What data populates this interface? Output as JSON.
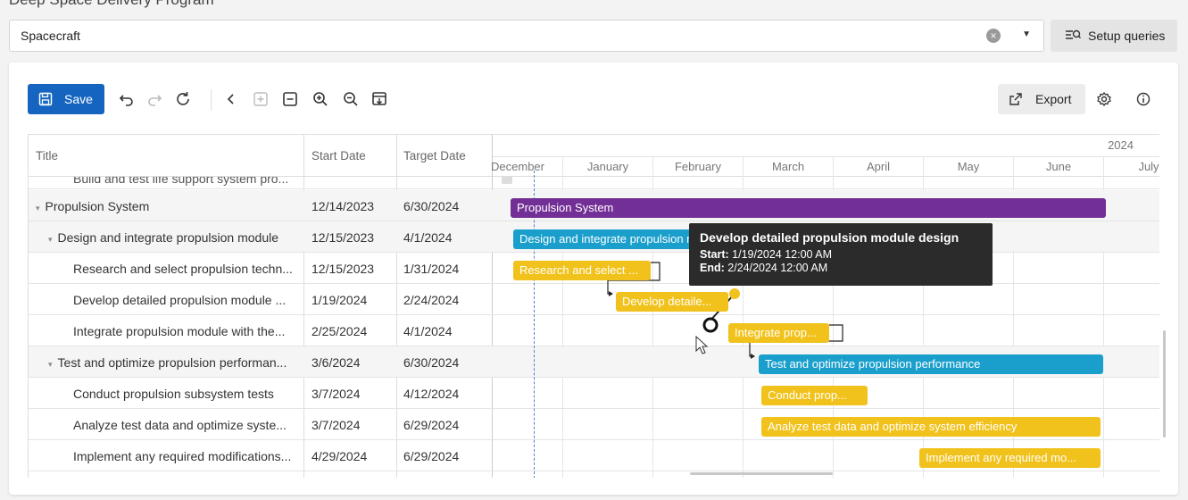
{
  "top_cut_text": "Deep Space Delivery Program",
  "query": {
    "value": "Spacecraft",
    "clear_icon": "circle-x-icon",
    "dropdown_icon": "chevron-down-icon"
  },
  "setup_queries": {
    "label": "Setup queries",
    "icon": "filter-search-icon"
  },
  "toolbar": {
    "save_label": "Save",
    "export_label": "Export",
    "icons": [
      "undo-icon",
      "redo-icon",
      "refresh-icon",
      "collapse-left-icon",
      "expand-all-icon",
      "collapse-all-icon",
      "zoom-in-icon",
      "zoom-out-icon",
      "fit-icon",
      "settings-icon",
      "info-icon"
    ]
  },
  "columns": {
    "title": "Title",
    "start": "Start Date",
    "target": "Target Date"
  },
  "timeline": {
    "year": "2024",
    "months": [
      "December",
      "January",
      "February",
      "March",
      "April",
      "May",
      "June",
      "July"
    ]
  },
  "rows": [
    {
      "title": "Build and test life support system pro...",
      "start": "",
      "target": "",
      "level": 2,
      "caret": ""
    },
    {
      "title": "Propulsion System",
      "start": "12/14/2023",
      "target": "6/30/2024",
      "level": 0,
      "caret": "▾"
    },
    {
      "title": "Design and integrate propulsion module",
      "start": "12/15/2023",
      "target": "4/1/2024",
      "level": 1,
      "caret": "▾"
    },
    {
      "title": "Research and select propulsion techn...",
      "start": "12/15/2023",
      "target": "1/31/2024",
      "level": 2,
      "caret": ""
    },
    {
      "title": "Develop detailed propulsion module ...",
      "start": "1/19/2024",
      "target": "2/24/2024",
      "level": 2,
      "caret": ""
    },
    {
      "title": "Integrate propulsion module with the...",
      "start": "2/25/2024",
      "target": "4/1/2024",
      "level": 2,
      "caret": ""
    },
    {
      "title": "Test and optimize propulsion performan...",
      "start": "3/6/2024",
      "target": "6/30/2024",
      "level": 1,
      "caret": "▾"
    },
    {
      "title": "Conduct propulsion subsystem tests",
      "start": "3/7/2024",
      "target": "4/12/2024",
      "level": 2,
      "caret": ""
    },
    {
      "title": "Analyze test data and optimize syste...",
      "start": "3/7/2024",
      "target": "6/29/2024",
      "level": 2,
      "caret": ""
    },
    {
      "title": "Implement any required modifications...",
      "start": "4/29/2024",
      "target": "6/29/2024",
      "level": 2,
      "caret": ""
    }
  ],
  "bars": [
    {
      "label": "Propulsion System",
      "color": "#722f96"
    },
    {
      "label": "Design and integrate propulsion module",
      "color": "#1a9fcc"
    },
    {
      "label": "Research and select ...",
      "color": "#f1c21b"
    },
    {
      "label": "Develop detaile...",
      "color": "#f1c21b"
    },
    {
      "label": "Integrate prop...",
      "color": "#f1c21b"
    },
    {
      "label": "Test and optimize propulsion performance",
      "color": "#1a9fcc"
    },
    {
      "label": "Conduct prop...",
      "color": "#f1c21b"
    },
    {
      "label": "Analyze test data and optimize system efficiency",
      "color": "#f1c21b"
    },
    {
      "label": "Implement any required mo...",
      "color": "#f1c21b"
    }
  ],
  "tooltip": {
    "title": "Develop detailed propulsion module design",
    "start_label": "Start:",
    "start_value": "1/19/2024 12:00 AM",
    "end_label": "End:",
    "end_value": "2/24/2024 12:00 AM"
  }
}
